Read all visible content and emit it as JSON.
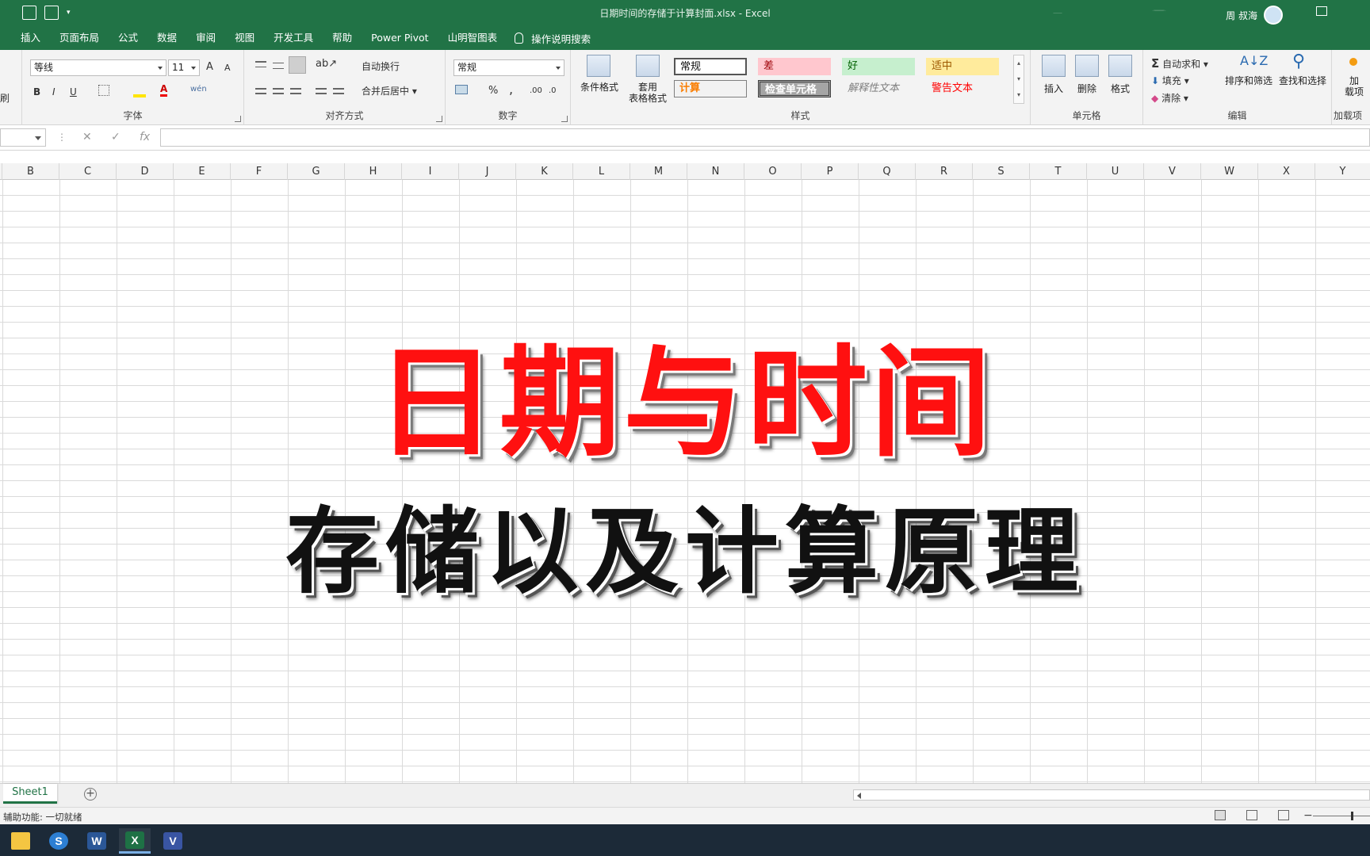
{
  "window": {
    "title": "日期时间的存储于计算封面.xlsx  -  Excel",
    "user": "周 叔海"
  },
  "tabs": [
    "插入",
    "页面布局",
    "公式",
    "数据",
    "审阅",
    "视图",
    "开发工具",
    "帮助",
    "Power Pivot",
    "山明智图表"
  ],
  "tell_me": "操作说明搜索",
  "ribbon": {
    "clipboard_partial": "刷",
    "font": {
      "label": "字体",
      "name": "等线",
      "size": "11",
      "grow": "A",
      "shrink": "A",
      "bold": "B",
      "italic": "I",
      "underline": "U",
      "wen": "wén"
    },
    "alignment": {
      "label": "对齐方式",
      "wrap": "自动换行",
      "merge": "合并后居中"
    },
    "number": {
      "label": "数字",
      "format": "常规",
      "percent": "%",
      "comma": ",",
      "inc_decimal": ".00",
      "dec_decimal": ".0"
    },
    "styles": {
      "label": "样式",
      "conditional": "条件格式",
      "table_top": "套用",
      "table_bottom": "表格格式",
      "cells": {
        "normal": "常规",
        "bad": "差",
        "good": "好",
        "neutral": "适中",
        "calc": "计算",
        "check": "检查单元格",
        "explain": "解释性文本",
        "warning": "警告文本"
      }
    },
    "cells_group": {
      "label": "单元格",
      "insert": "插入",
      "delete": "删除",
      "format": "格式"
    },
    "editing": {
      "label": "编辑",
      "autosum": "自动求和",
      "fill": "填充",
      "clear": "清除",
      "sort": "排序和筛选",
      "find": "查找和选择"
    },
    "addins": {
      "label": "加载项",
      "btn_top": "加",
      "btn_bottom": "载项"
    }
  },
  "formula_bar": {
    "cancel": "✕",
    "enter": "✓",
    "fx": "fx",
    "value": ""
  },
  "columns": [
    "B",
    "C",
    "D",
    "E",
    "F",
    "G",
    "H",
    "I",
    "J",
    "K",
    "L",
    "M",
    "N",
    "O",
    "P",
    "Q",
    "R",
    "S",
    "T",
    "U",
    "V",
    "W",
    "X",
    "Y"
  ],
  "content": {
    "headline": "日期与时间",
    "subhead": "存储以及计算原理"
  },
  "sheets": [
    "Sheet1"
  ],
  "status": {
    "accessibility": "辅助功能: 一切就绪",
    "zoom_minus": "−"
  },
  "taskbar": {
    "apps": [
      "file-explorer",
      "sogou",
      "word",
      "excel",
      "visio"
    ],
    "letters": {
      "word": "W",
      "excel": "X",
      "visio": "V",
      "sogou": "S"
    }
  },
  "colors": {
    "excel_green": "#217346",
    "headline_red": "#ff1010"
  }
}
